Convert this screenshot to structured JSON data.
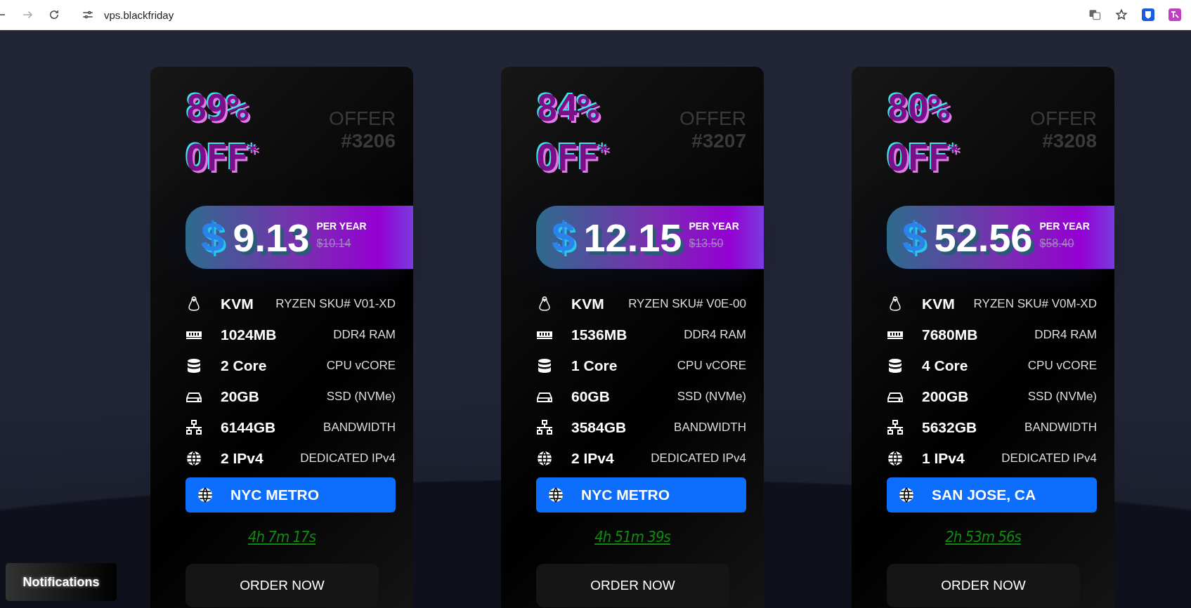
{
  "browser": {
    "url": "vps.blackfriday"
  },
  "offers": [
    {
      "discount": "89%",
      "off": "OFF$^{*}$",
      "offer_label": "OFFER",
      "offer_number": "#3206",
      "currency": "$",
      "price": "9.13",
      "period": "PER YEAR",
      "old_price": "$10.14",
      "specs": [
        {
          "kind": "os",
          "amount": "KVM",
          "detail": "RYZEN SKU# V01-XD"
        },
        {
          "kind": "ram",
          "amount": "1024MB",
          "detail": "DDR4 RAM"
        },
        {
          "kind": "cpu",
          "amount": "2 Core",
          "detail": "CPU vCORE"
        },
        {
          "kind": "disk",
          "amount": "20GB",
          "detail": "SSD (NVMe)"
        },
        {
          "kind": "network",
          "amount": "6144GB",
          "detail": "BANDWIDTH"
        },
        {
          "kind": "ip",
          "amount": "2 IPv4",
          "detail": "DEDICATED IPv4"
        }
      ],
      "location": "NYC METRO",
      "timer": "4h 7m 17s",
      "order": "ORDER NOW"
    },
    {
      "discount": "84%",
      "off": "OFF$^{*}$",
      "offer_label": "OFFER",
      "offer_number": "#3207",
      "currency": "$",
      "price": "12.15",
      "period": "PER YEAR",
      "old_price": "$13.50",
      "specs": [
        {
          "kind": "os",
          "amount": "KVM",
          "detail": "RYZEN SKU# V0E-00"
        },
        {
          "kind": "ram",
          "amount": "1536MB",
          "detail": "DDR4 RAM"
        },
        {
          "kind": "cpu",
          "amount": "1 Core",
          "detail": "CPU vCORE"
        },
        {
          "kind": "disk",
          "amount": "60GB",
          "detail": "SSD (NVMe)"
        },
        {
          "kind": "network",
          "amount": "3584GB",
          "detail": "BANDWIDTH"
        },
        {
          "kind": "ip",
          "amount": "2 IPv4",
          "detail": "DEDICATED IPv4"
        }
      ],
      "location": "NYC METRO",
      "timer": "4h 51m 39s",
      "order": "ORDER NOW"
    },
    {
      "discount": "80%",
      "off": "OFF$^{*}$",
      "offer_label": "OFFER",
      "offer_number": "#3208",
      "currency": "$",
      "price": "52.56",
      "period": "PER YEAR",
      "old_price": "$58.40",
      "specs": [
        {
          "kind": "os",
          "amount": "KVM",
          "detail": "RYZEN SKU# V0M-XD"
        },
        {
          "kind": "ram",
          "amount": "7680MB",
          "detail": "DDR4 RAM"
        },
        {
          "kind": "cpu",
          "amount": "4 Core",
          "detail": "CPU vCORE"
        },
        {
          "kind": "disk",
          "amount": "200GB",
          "detail": "SSD (NVMe)"
        },
        {
          "kind": "network",
          "amount": "5632GB",
          "detail": "BANDWIDTH"
        },
        {
          "kind": "ip",
          "amount": "1 IPv4",
          "detail": "DEDICATED IPv4"
        }
      ],
      "location": "SAN JOSE, CA",
      "timer": "2h 53m 56s",
      "order": "ORDER NOW"
    }
  ],
  "notifications": {
    "label": "Notifications"
  }
}
